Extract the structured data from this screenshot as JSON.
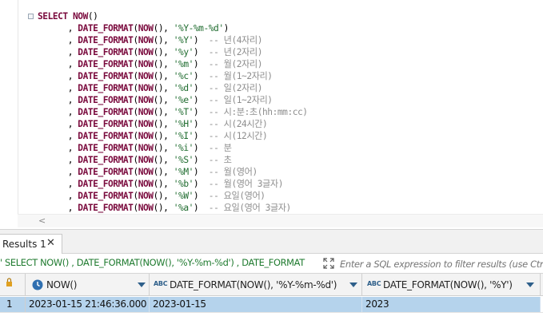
{
  "editor": {
    "lines": [
      {
        "kind": "select",
        "keyword": "SELECT",
        "func": "NOW",
        "parens": "()"
      },
      {
        "kind": "fmt",
        "fmt": "'%Y-%m-%d'",
        "comment": ""
      },
      {
        "kind": "fmt",
        "fmt": "'%Y'",
        "comment": "-- 년(4자리)"
      },
      {
        "kind": "fmt",
        "fmt": "'%y'",
        "comment": "-- 년(2자리)"
      },
      {
        "kind": "fmt",
        "fmt": "'%m'",
        "comment": "-- 월(2자리)"
      },
      {
        "kind": "fmt",
        "fmt": "'%c'",
        "comment": "-- 월(1~2자리)"
      },
      {
        "kind": "fmt",
        "fmt": "'%d'",
        "comment": "-- 일(2자리)"
      },
      {
        "kind": "fmt",
        "fmt": "'%e'",
        "comment": "-- 일(1~2자리)"
      },
      {
        "kind": "fmt",
        "fmt": "'%T'",
        "comment": "-- 시:분:초(hh:mm:cc)"
      },
      {
        "kind": "fmt",
        "fmt": "'%H'",
        "comment": "-- 시(24시간)"
      },
      {
        "kind": "fmt",
        "fmt": "'%I'",
        "comment": "-- 시(12시간)"
      },
      {
        "kind": "fmt",
        "fmt": "'%i'",
        "comment": "-- 분"
      },
      {
        "kind": "fmt",
        "fmt": "'%S'",
        "comment": "-- 초"
      },
      {
        "kind": "fmt",
        "fmt": "'%M'",
        "comment": "-- 월(영어)"
      },
      {
        "kind": "fmt",
        "fmt": "'%b'",
        "comment": "-- 월(영어 3글자)"
      },
      {
        "kind": "fmt",
        "fmt": "'%W'",
        "comment": "-- 요일(영어)"
      },
      {
        "kind": "fmt",
        "fmt": "'%a'",
        "comment": "-- 요일(영어 3글자)"
      }
    ],
    "tokens": {
      "comma": ", ",
      "func": "DATE_FORMAT",
      "now": "NOW",
      "open": "(",
      "close": ")",
      "inner_sep": "(), "
    },
    "scroll_arrow": "<"
  },
  "results_tab": {
    "label": "Results 1",
    "close_glyph": "✕"
  },
  "filter": {
    "sql_text": "' SELECT NOW() , DATE_FORMAT(NOW(), '%Y-%m-%d') , DATE_FORMAT",
    "placeholder": "Enter a SQL expression to filter results (use Ctrl"
  },
  "grid": {
    "columns": [
      {
        "label": "NOW()",
        "icon": "clock-icon"
      },
      {
        "label": "DATE_FORMAT(NOW(), '%Y-%m-%d')",
        "icon": "abc-icon",
        "icon_text": "ABC"
      },
      {
        "label": "DATE_FORMAT(NOW(), '%Y')",
        "icon": "abc-icon",
        "icon_text": "ABC"
      }
    ],
    "rows": [
      {
        "num": "1",
        "cells": [
          "2023-01-15 21:46:36.000",
          "2023-01-15",
          "2023"
        ]
      }
    ]
  },
  "colors": {
    "keyword": "#7a0a3d",
    "string": "#1e6b2e",
    "comment": "#8d8d8d",
    "identifier": "#000080",
    "selection": "#b5d3ec",
    "accent": "#2e5f8a"
  }
}
